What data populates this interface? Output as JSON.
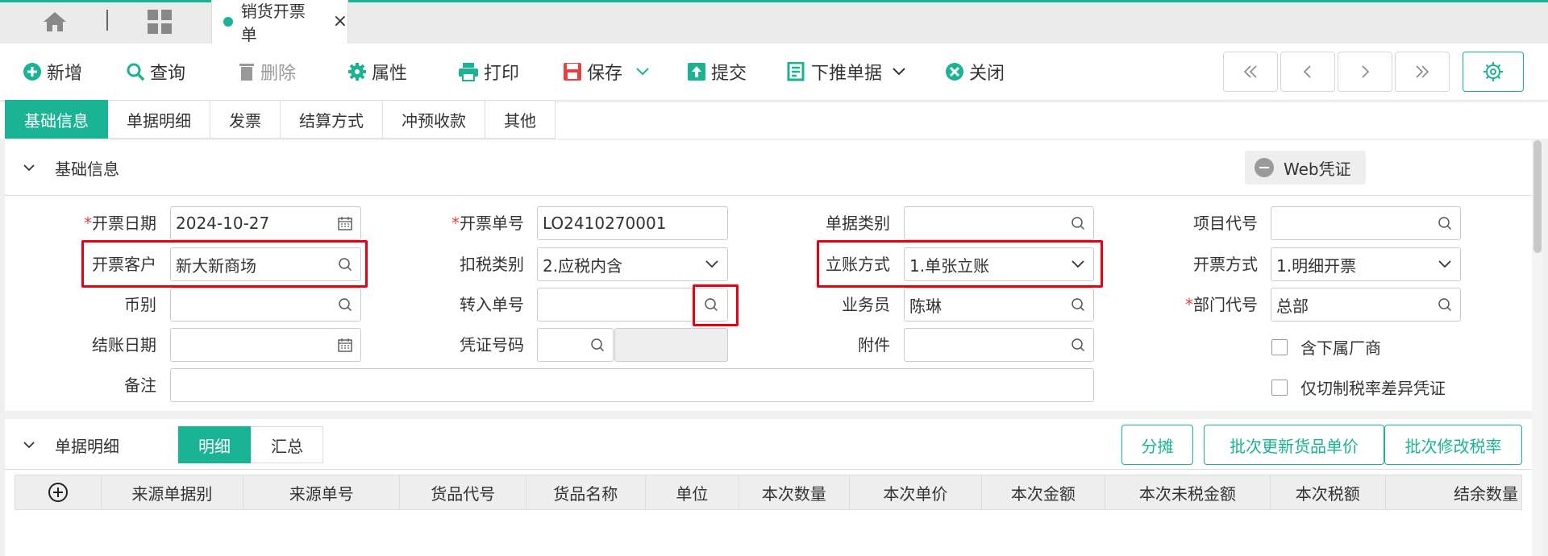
{
  "top_tabs": {
    "doc_tab_label": "销货开票单"
  },
  "toolbar": {
    "new": "新增",
    "query": "查询",
    "delete": "删除",
    "properties": "属性",
    "print": "打印",
    "save": "保存",
    "submit": "提交",
    "push_down": "下推单据",
    "close": "关闭"
  },
  "section_tabs": [
    "基础信息",
    "单据明细",
    "发票",
    "结算方式",
    "冲预收款",
    "其他"
  ],
  "basic_info": {
    "title": "基础信息",
    "web_voucher": "Web凭证",
    "fields": {
      "invoice_date_label": "开票日期",
      "invoice_date": "2024-10-27",
      "customer_label": "开票客户",
      "customer": "新大新商场",
      "currency_label": "币别",
      "currency": "",
      "close_date_label": "结账日期",
      "close_date": "",
      "remark_label": "备注",
      "remark": "",
      "invoice_no_label": "开票单号",
      "invoice_no": "LO2410270001",
      "tax_type_label": "扣税类别",
      "tax_type": "2.应税内含",
      "transfer_no_label": "转入单号",
      "transfer_no": "",
      "voucher_no_label": "凭证号码",
      "voucher_no": "",
      "doc_type_label": "单据类别",
      "doc_type": "",
      "account_method_label": "立账方式",
      "account_method": "1.单张立账",
      "salesperson_label": "业务员",
      "salesperson": "陈琳",
      "attachment_label": "附件",
      "attachment": "",
      "project_code_label": "项目代号",
      "project_code": "",
      "invoice_method_label": "开票方式",
      "invoice_method": "1.明细开票",
      "dept_code_label": "部门代号",
      "dept_code": "总部",
      "include_sub_vendor": "含下属厂商",
      "only_tax_diff_voucher": "仅切制税率差异凭证"
    }
  },
  "details": {
    "title": "单据明细",
    "segments": [
      "明细",
      "汇总"
    ],
    "buttons": [
      "分摊",
      "批次更新货品单价",
      "批次修改税率"
    ],
    "columns": [
      "来源单据别",
      "来源单号",
      "货品代号",
      "货品名称",
      "单位",
      "本次数量",
      "本次单价",
      "本次金额",
      "本次未税金额",
      "本次税额",
      "结余数量"
    ]
  },
  "colors": {
    "accent": "#1ab394",
    "highlight": "#e60012",
    "required": "#e64242"
  }
}
